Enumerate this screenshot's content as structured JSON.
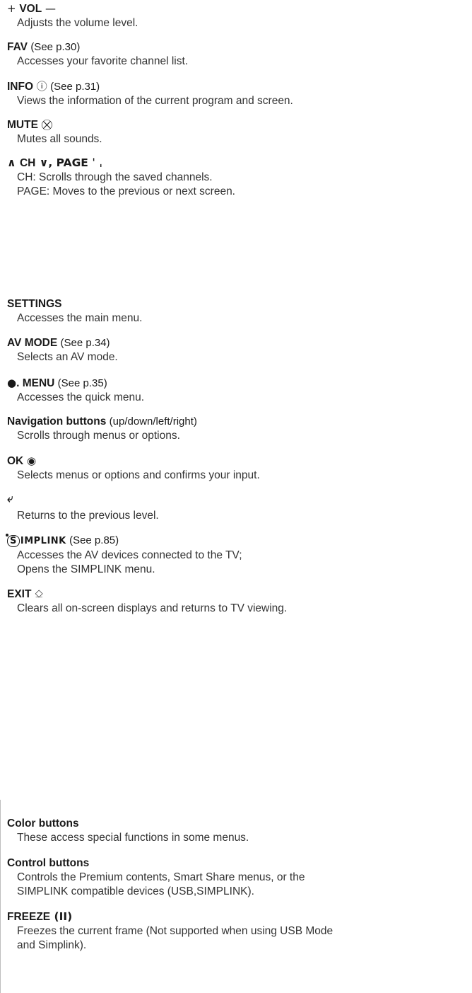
{
  "entries": [
    {
      "id": "vol",
      "term": "VOL",
      "sym_before": "+ ",
      "sym_after": " —",
      "ref": "",
      "desc": [
        "Adjusts the volume level."
      ]
    },
    {
      "id": "fav",
      "term": "FAV",
      "ref": "(See p.30)",
      "desc": [
        "Accesses your favorite channel list."
      ]
    },
    {
      "id": "info",
      "term": "INFO",
      "sym_after": " ⓘ",
      "ref": "(See p.31)",
      "desc": [
        "Views the information of the current program and screen."
      ]
    },
    {
      "id": "mute",
      "term": "MUTE",
      "sym_after": " ⛒",
      "ref": "",
      "desc": [
        "Mutes all sounds."
      ]
    },
    {
      "id": "ch-page",
      "term": "CH",
      "sym_before": "∧ ",
      "sym_after": " ∨, PAGE ˈ ˌ",
      "ref": "",
      "desc": [
        "CH: Scrolls through the saved channels.",
        "PAGE: Moves to the previous or next screen."
      ]
    },
    {
      "id": "settings",
      "term": "SETTINGS",
      "ref": "",
      "desc": [
        "Accesses the main menu."
      ]
    },
    {
      "id": "av-mode",
      "term": "AV MODE",
      "ref": "(See p.34)",
      "desc": [
        "Selects an AV mode."
      ]
    },
    {
      "id": "q-menu",
      "term": ". MENU",
      "sym_before": "●",
      "ref": "(See p.35)",
      "desc": [
        "Accesses the quick menu."
      ]
    },
    {
      "id": "navigation",
      "term": "Navigation buttons",
      "ref": "(up/down/left/right)",
      "desc": [
        "Scrolls through menus or options."
      ]
    },
    {
      "id": "ok",
      "term": "OK",
      "sym_after": " ◉",
      "ref": "",
      "desc": [
        "Selects menus or options and confirms your input."
      ]
    },
    {
      "id": "back",
      "term": "",
      "sym_before": "⤶",
      "ref": "",
      "desc": [
        "Returns to the previous level."
      ]
    },
    {
      "id": "simplink",
      "term": "",
      "logo": "SIMPLINK",
      "ref": "(See p.85)",
      "desc": [
        "Accesses the AV devices connected to the TV;",
        "Opens the SIMPLINK menu."
      ]
    },
    {
      "id": "exit",
      "term": "EXIT",
      "sym_after": " ⎐",
      "ref": "",
      "desc": [
        "Clears all on-screen displays and returns to TV viewing."
      ]
    },
    {
      "id": "color",
      "term": "Color buttons",
      "ref": "",
      "desc": [
        "These access special functions in some menus."
      ]
    },
    {
      "id": "control",
      "term": "Control buttons",
      "ref": "",
      "desc": [
        "Controls the Premium contents, Smart Share menus, or the",
        "SIMPLINK compatible devices (USB,SIMPLINK)."
      ]
    },
    {
      "id": "freeze",
      "term": "FREEZE",
      "sym_after": " (II)",
      "ref": "",
      "desc": [
        "Freezes the current frame (Not supported when using USB Mode",
        "and Simplink)."
      ]
    }
  ]
}
